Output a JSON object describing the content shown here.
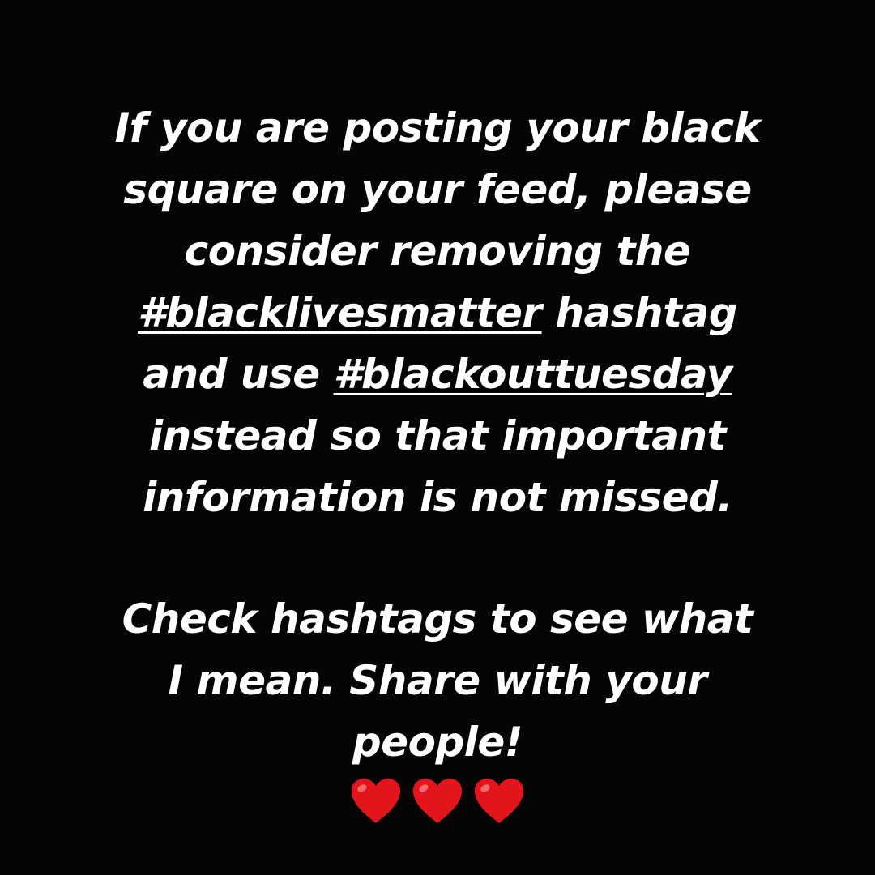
{
  "post": {
    "lines": [
      "If you are posting your black",
      "square on your feed, please",
      "consider removing the",
      "hashtag",
      "and use",
      "instead so that important",
      "information is not missed.",
      "Check hashtags to see what",
      "I mean. Share with your",
      "people!"
    ],
    "hashtags": {
      "blm": "#blacklivesmatter",
      "blackout": "#blackouttuesday"
    },
    "text_color": "#ffffff",
    "background_color": "#050505"
  },
  "hearts": {
    "count": 3,
    "color": "#e3141b",
    "icon": "red-heart-emoji"
  }
}
